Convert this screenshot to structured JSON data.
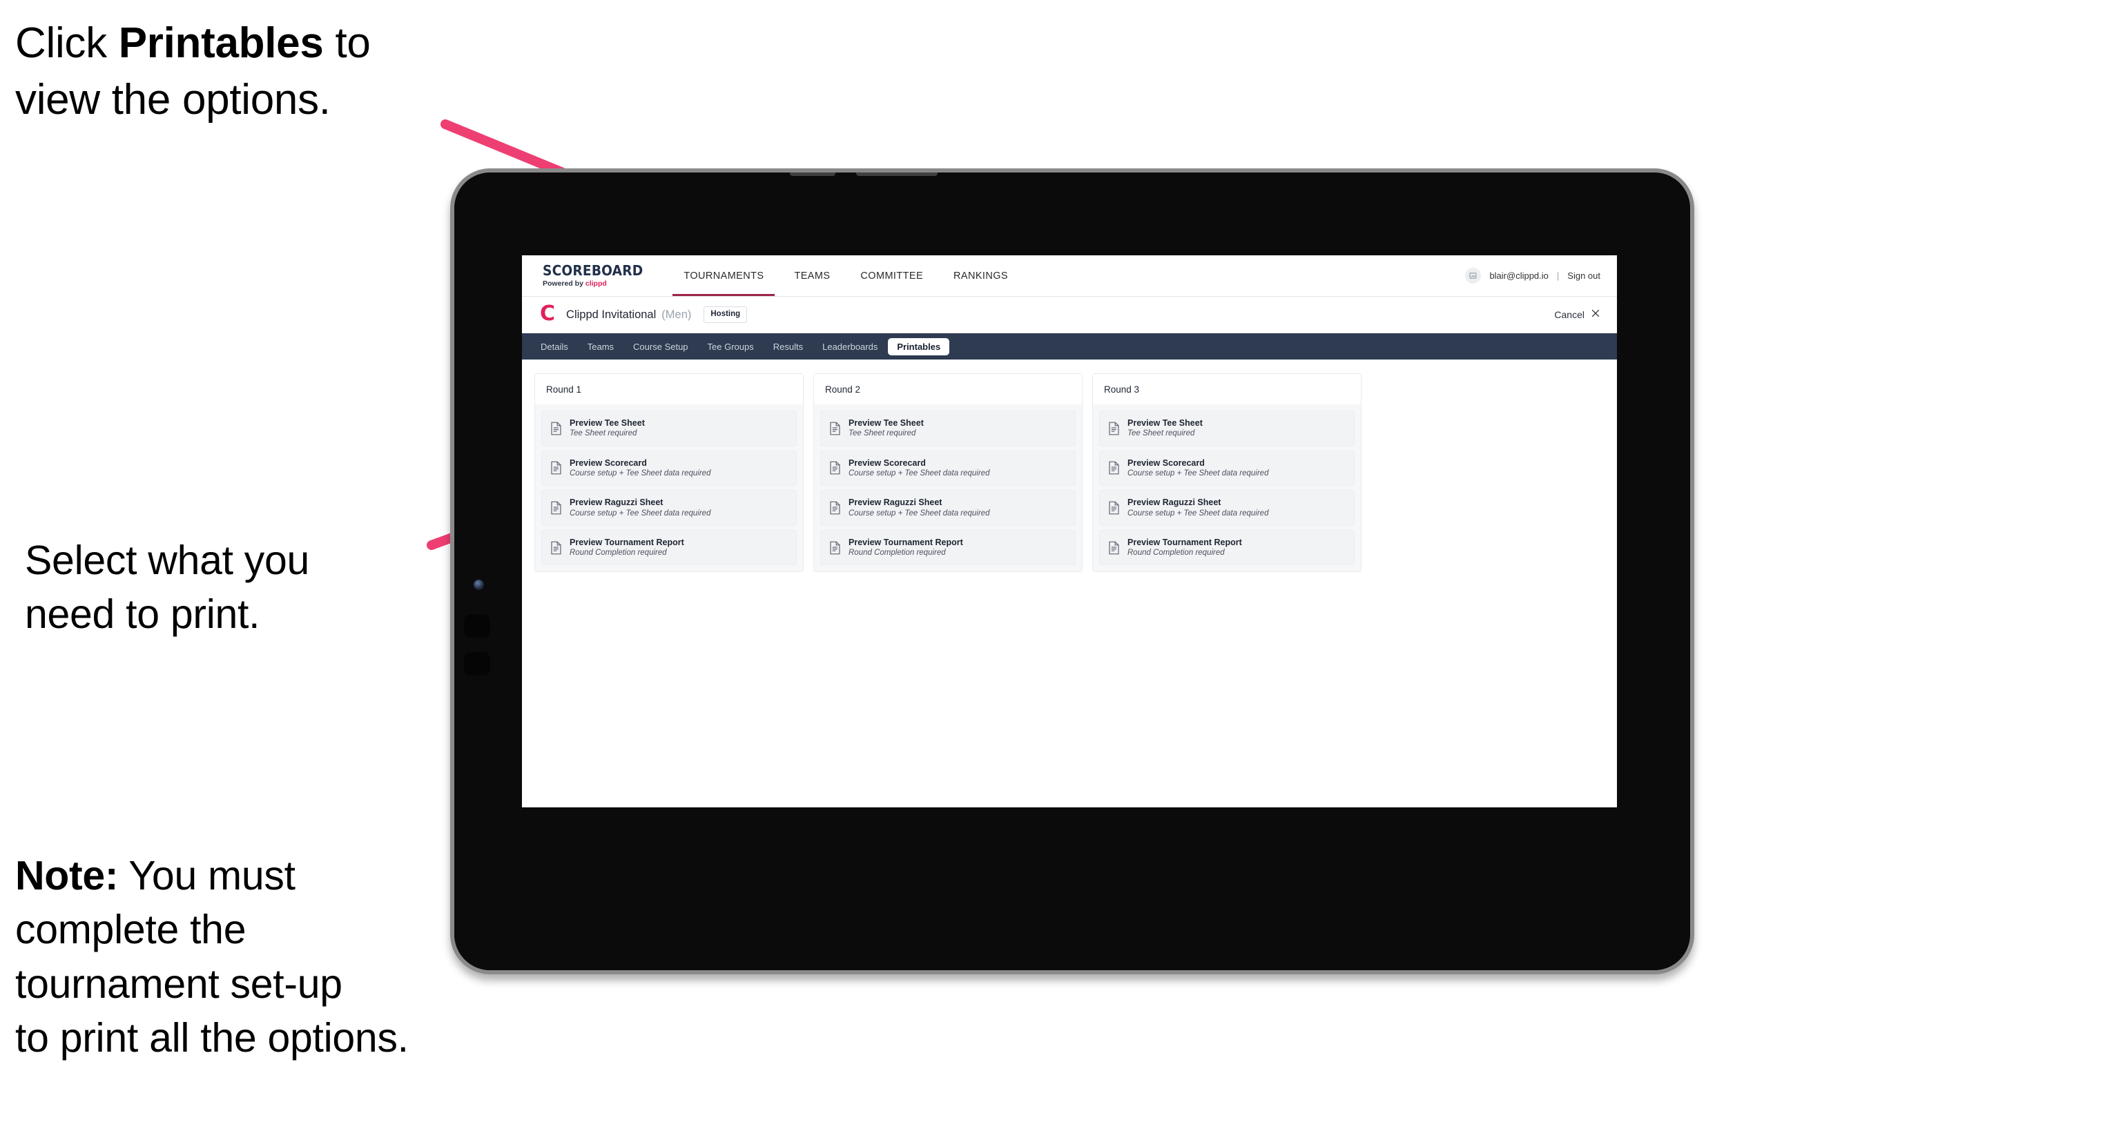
{
  "annotations": {
    "click_printables": "Click Printables to\nview the options.",
    "click_printables_plain_1": "Click ",
    "click_printables_bold": "Printables",
    "click_printables_plain_2": " to\nview the options.",
    "select_what": "Select what you\n need to print.",
    "note_bold": "Note:",
    "note_rest": " You must\ncomplete the\ntournament set-up\nto print all the options."
  },
  "colors": {
    "arrow_pink": "#ee3f72",
    "brand_accent": "#e0215c",
    "nav_underline": "#9d2449",
    "tabbar_bg": "#2e3b51",
    "tablet_frame": "#0c0c0c"
  },
  "app": {
    "brand": {
      "title": "SCOREBOARD",
      "subtitle_prefix": "Powered by ",
      "subtitle_brand": "clippd"
    },
    "main_nav": [
      {
        "label": "TOURNAMENTS",
        "active": true
      },
      {
        "label": "TEAMS",
        "active": false
      },
      {
        "label": "COMMITTEE",
        "active": false
      },
      {
        "label": "RANKINGS",
        "active": false
      }
    ],
    "account": {
      "avatar_icon": "user-avatar-icon",
      "email": "blair@clippd.io",
      "separator": "|",
      "sign_out": "Sign out"
    },
    "tournament": {
      "logo_letter": "C",
      "name": "Clippd Invitational",
      "gender": "(Men)",
      "status_badge": "Hosting",
      "cancel_label": "Cancel",
      "cancel_icon": "close-icon"
    },
    "tabs": [
      {
        "label": "Details",
        "active": false
      },
      {
        "label": "Teams",
        "active": false
      },
      {
        "label": "Course Setup",
        "active": false
      },
      {
        "label": "Tee Groups",
        "active": false
      },
      {
        "label": "Results",
        "active": false
      },
      {
        "label": "Leaderboards",
        "active": false
      },
      {
        "label": "Printables",
        "active": true
      }
    ],
    "rounds": [
      {
        "title": "Round 1",
        "items": [
          {
            "title": "Preview Tee Sheet",
            "subtitle": "Tee Sheet required",
            "icon": "document-icon"
          },
          {
            "title": "Preview Scorecard",
            "subtitle": "Course setup + Tee Sheet data required",
            "icon": "document-icon"
          },
          {
            "title": "Preview Raguzzi Sheet",
            "subtitle": "Course setup + Tee Sheet data required",
            "icon": "document-icon"
          },
          {
            "title": "Preview Tournament Report",
            "subtitle": "Round Completion required",
            "icon": "document-icon"
          }
        ]
      },
      {
        "title": "Round 2",
        "items": [
          {
            "title": "Preview Tee Sheet",
            "subtitle": "Tee Sheet required",
            "icon": "document-icon"
          },
          {
            "title": "Preview Scorecard",
            "subtitle": "Course setup + Tee Sheet data required",
            "icon": "document-icon"
          },
          {
            "title": "Preview Raguzzi Sheet",
            "subtitle": "Course setup + Tee Sheet data required",
            "icon": "document-icon"
          },
          {
            "title": "Preview Tournament Report",
            "subtitle": "Round Completion required",
            "icon": "document-icon"
          }
        ]
      },
      {
        "title": "Round 3",
        "items": [
          {
            "title": "Preview Tee Sheet",
            "subtitle": "Tee Sheet required",
            "icon": "document-icon"
          },
          {
            "title": "Preview Scorecard",
            "subtitle": "Course setup + Tee Sheet data required",
            "icon": "document-icon"
          },
          {
            "title": "Preview Raguzzi Sheet",
            "subtitle": "Course setup + Tee Sheet data required",
            "icon": "document-icon"
          },
          {
            "title": "Preview Tournament Report",
            "subtitle": "Round Completion required",
            "icon": "document-icon"
          }
        ]
      }
    ]
  }
}
